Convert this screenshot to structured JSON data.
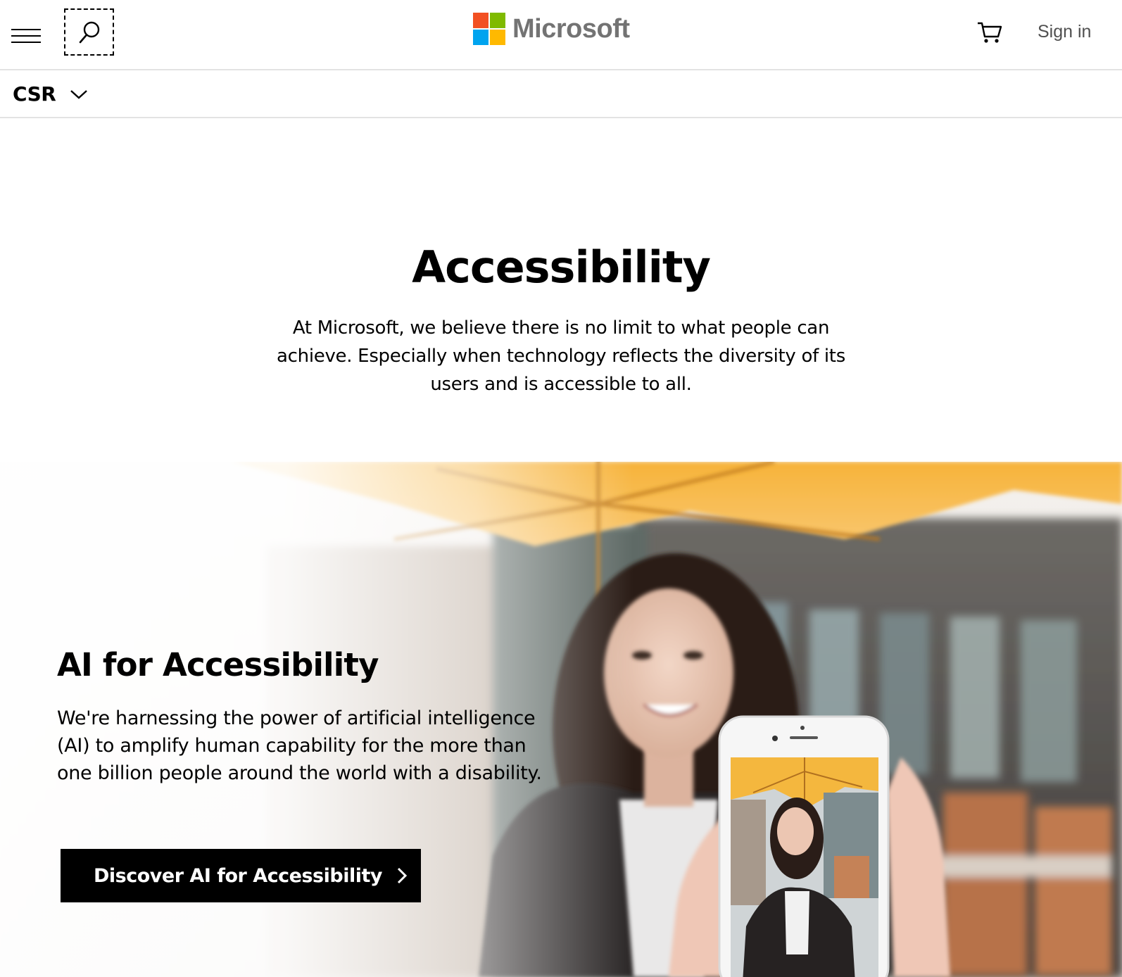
{
  "header": {
    "menu_icon": "hamburger-menu-icon",
    "search_icon": "search-icon",
    "logo_text": "Microsoft",
    "logo_colors": [
      "#f25022",
      "#7fba00",
      "#00a4ef",
      "#ffb900"
    ],
    "cart_icon": "shopping-cart-icon",
    "signin_label": "Sign in"
  },
  "subnav": {
    "section_label": "CSR",
    "dropdown_icon": "chevron-down-icon"
  },
  "intro": {
    "title": "Accessibility",
    "text": "At Microsoft, we believe there is no limit to what people can achieve. Especially when technology reflects the diversity of its users and is accessible to all."
  },
  "hero": {
    "heading": "AI for Accessibility",
    "text": "We're harnessing the power of artificial intelligence (AI) to amplify human capability for the more than one billion people around the world with a disability.",
    "cta_label": "Discover AI for Accessibility",
    "cta_icon": "chevron-right-icon",
    "accent_color": "#f5b53f"
  }
}
